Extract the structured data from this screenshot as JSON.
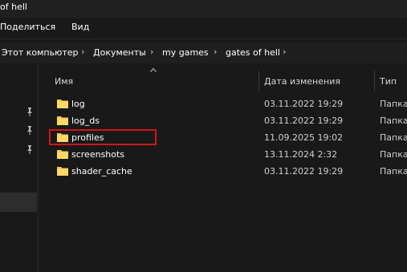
{
  "window": {
    "title": "of hell"
  },
  "menu": {
    "items": [
      "Поделиться",
      "Вид"
    ]
  },
  "breadcrumb": [
    "Этот компьютер",
    "Документы",
    "my games",
    "gates of hell"
  ],
  "columns": {
    "name": "Имя",
    "date": "Дата изменения",
    "type": "Тип"
  },
  "files": [
    {
      "name": "log",
      "date": "03.11.2022 19:29",
      "type": "Папка"
    },
    {
      "name": "log_ds",
      "date": "03.11.2022 19:29",
      "type": "Папка"
    },
    {
      "name": "profiles",
      "date": "11.09.2025 19:02",
      "type": "Папка",
      "highlighted": true
    },
    {
      "name": "screenshots",
      "date": "13.11.2024 2:32",
      "type": "Папка"
    },
    {
      "name": "shader_cache",
      "date": "03.11.2022 19:29",
      "type": "Папка"
    }
  ],
  "colors": {
    "folder": "#f3c94c",
    "highlight": "#d0151b",
    "background": "#191919"
  }
}
